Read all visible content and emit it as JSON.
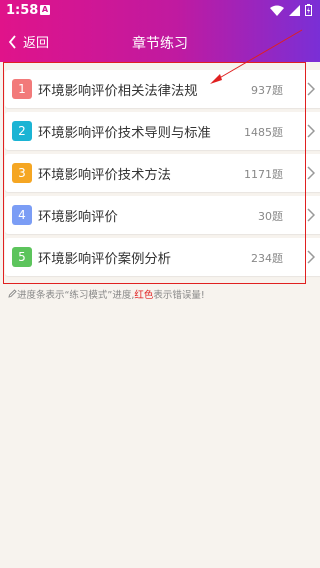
{
  "status_bar": {
    "time": "1:58",
    "sim_label": "A"
  },
  "nav": {
    "back_label": "返回",
    "title": "章节练习"
  },
  "chapters": [
    {
      "index": "1",
      "title": "环境影响评价相关法律法规",
      "count": "937题",
      "color": "#f27a7a"
    },
    {
      "index": "2",
      "title": "环境影响评价技术导则与标准",
      "count": "1485题",
      "color": "#1bb4d4"
    },
    {
      "index": "3",
      "title": "环境影响评价技术方法",
      "count": "1171题",
      "color": "#f5a623"
    },
    {
      "index": "4",
      "title": "环境影响评价",
      "count": "30题",
      "color": "#7b9df5"
    },
    {
      "index": "5",
      "title": "环境影响评价案例分析",
      "count": "234题",
      "color": "#5cc45c"
    }
  ],
  "footer_note": {
    "prefix": "进度条表示“练习模式”进度,",
    "highlight": "红色",
    "suffix": "表示错误量!"
  },
  "colors": {
    "annotation": "#e02020"
  }
}
